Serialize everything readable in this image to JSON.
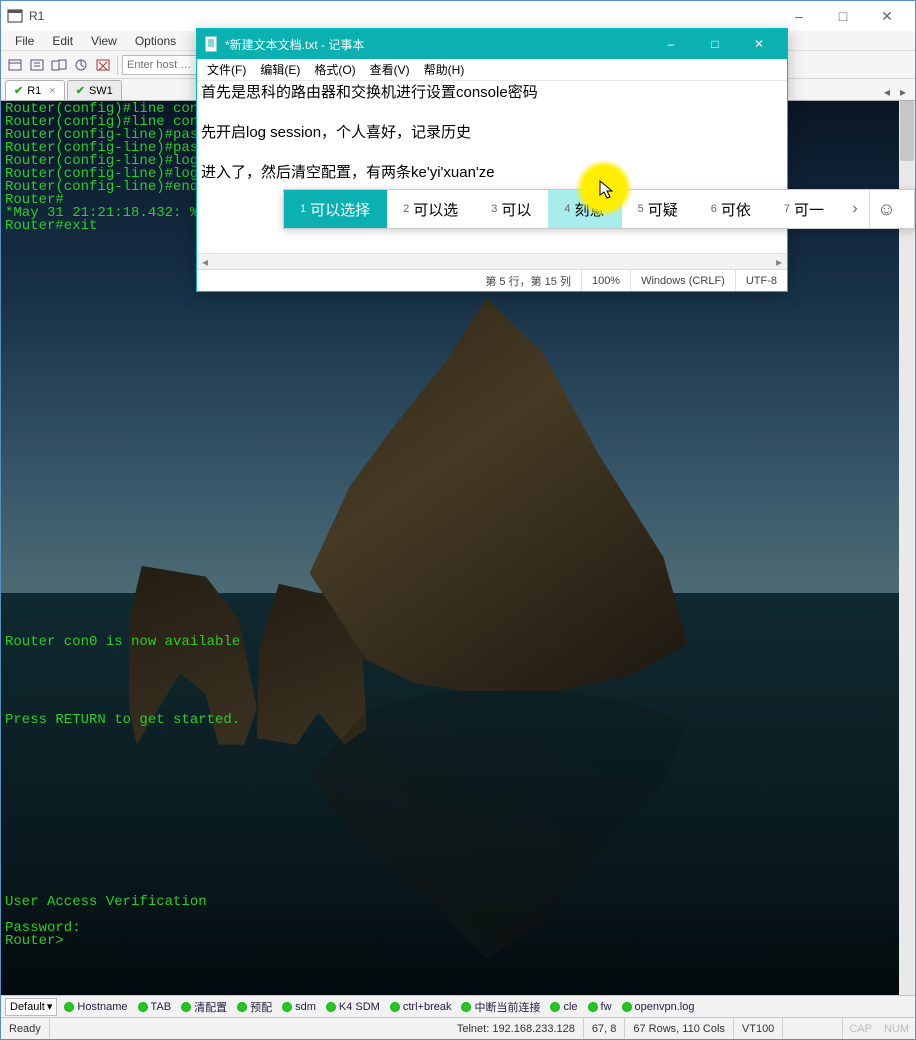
{
  "main": {
    "title": "R1",
    "menus": [
      "File",
      "Edit",
      "View",
      "Options"
    ],
    "host_placeholder": "Enter host …",
    "tabs": [
      {
        "label": "R1",
        "active": true,
        "closeable": true
      },
      {
        "label": "SW1",
        "active": false,
        "closeable": false
      }
    ],
    "terminal_lines": [
      "Router(config)#line con",
      "Router(config)#line con",
      "Router(config-line)#pas",
      "Router(config-line)#pas",
      "Router(config-line)#log",
      "Router(config-line)#log",
      "Router(config-line)#end",
      "Router#",
      "*May 31 21:21:18.432: %",
      "Router#exit",
      "",
      "",
      "",
      "",
      "",
      "",
      "",
      "",
      "",
      "",
      "",
      "",
      "",
      "",
      "",
      "",
      "",
      "",
      "",
      "",
      "",
      "",
      "",
      "",
      "",
      "",
      "",
      "",
      "",
      "",
      "",
      "Router con0 is now available",
      "",
      "",
      "",
      "",
      "",
      "Press RETURN to get started.",
      "",
      "",
      "",
      "",
      "",
      "",
      "",
      "",
      "",
      "",
      "",
      "",
      "",
      "User Access Verification",
      "",
      "Password:",
      "Router>"
    ]
  },
  "macro_bar": {
    "dropdown": "Default",
    "macros": [
      "Hostname",
      "TAB",
      "清配置",
      "预配",
      "sdm",
      "K4 SDM",
      "ctrl+break",
      "中断当前连接",
      "cle",
      "fw",
      "openvpn.log"
    ]
  },
  "status": {
    "ready": "Ready",
    "telnet": "Telnet: 192.168.233.128",
    "cursor": "67,   8",
    "size": "67 Rows, 110 Cols",
    "term": "VT100",
    "cap": "CAP",
    "num": "NUM"
  },
  "notepad": {
    "title": "*新建文本文档.txt - 记事本",
    "menus": [
      "文件(F)",
      "编辑(E)",
      "格式(O)",
      "查看(V)",
      "帮助(H)"
    ],
    "paragraphs": [
      "首先是思科的路由器和交换机进行设置console密码",
      "先开启log session，个人喜好，记录历史",
      "进入了，然后清空配置，有两条ke'yi'xuan'ze"
    ],
    "status": {
      "pos": "第 5 行，第 15 列",
      "zoom": "100%",
      "eol": "Windows (CRLF)",
      "enc": "UTF-8"
    }
  },
  "ime": {
    "candidates": [
      {
        "n": "1",
        "text": "可以选择",
        "sel": true
      },
      {
        "n": "2",
        "text": "可以选"
      },
      {
        "n": "3",
        "text": "可以"
      },
      {
        "n": "4",
        "text": "刻意",
        "hl": true
      },
      {
        "n": "5",
        "text": "可疑"
      },
      {
        "n": "6",
        "text": "可依"
      },
      {
        "n": "7",
        "text": "可一"
      }
    ]
  }
}
